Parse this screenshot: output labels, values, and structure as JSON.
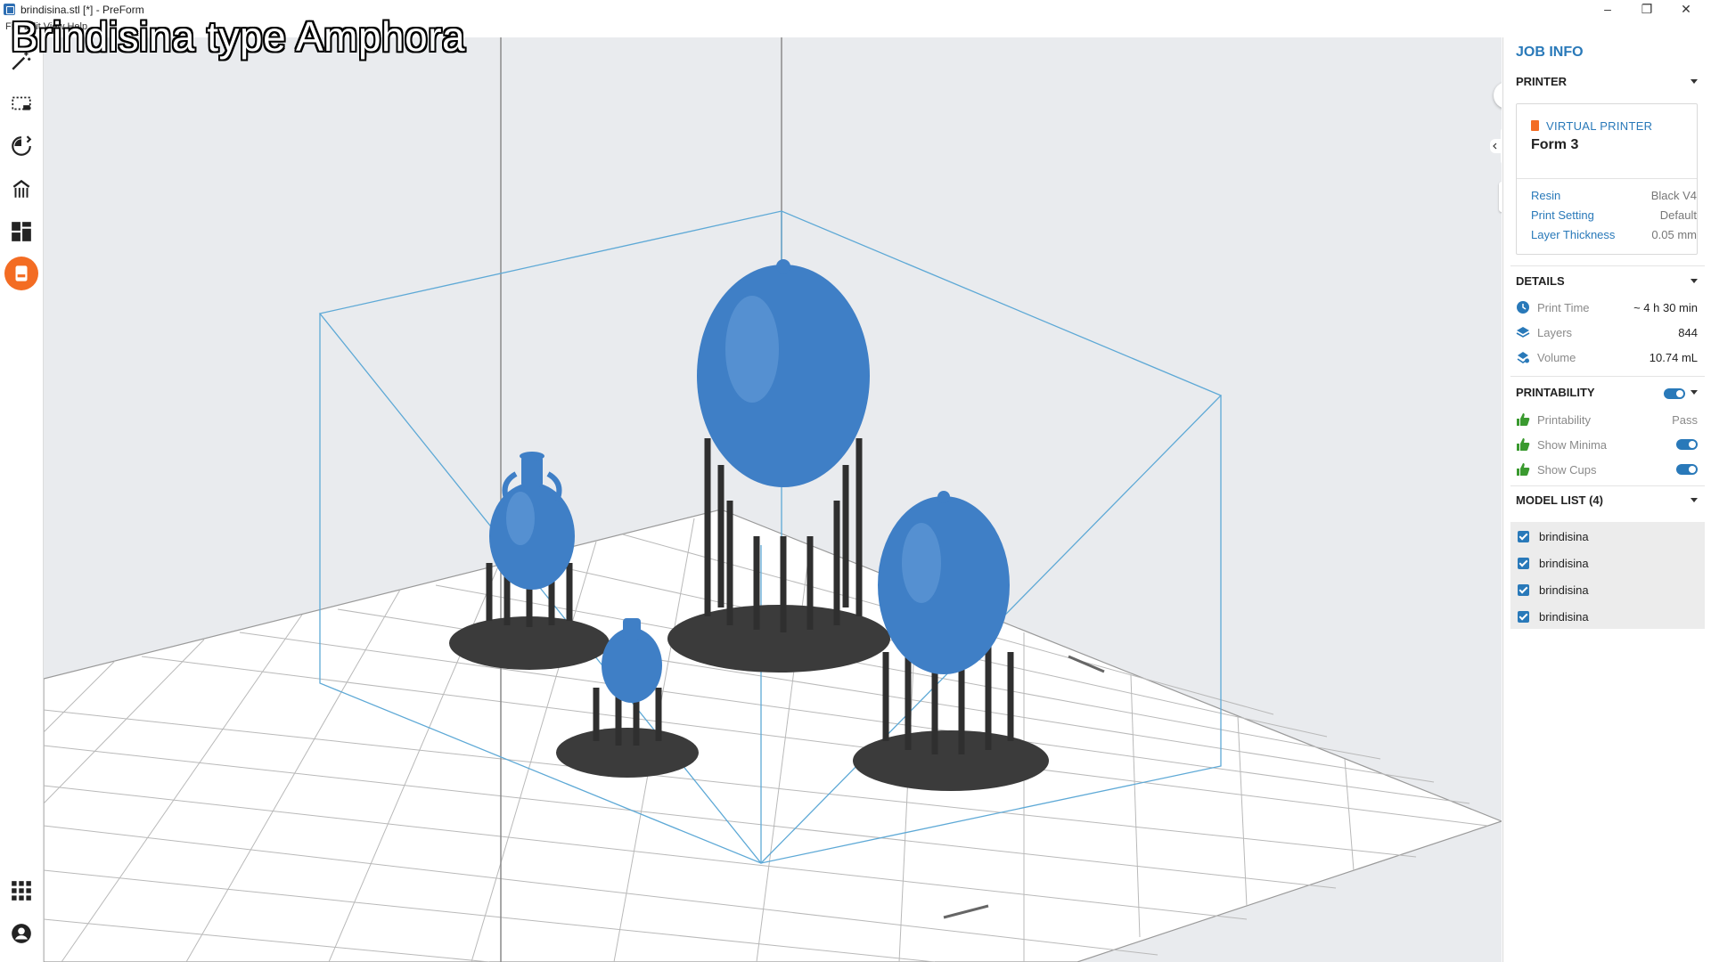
{
  "window": {
    "title": "brindisina.stl [*] - PreForm",
    "menu_ghost": "File  Edit  View  Help",
    "controls": {
      "minimize": "–",
      "maximize": "❐",
      "close": "✕"
    }
  },
  "overlay_caption": "Brindisina type Amphora",
  "toolbar": {
    "tools": [
      "magic-wand",
      "select",
      "orientation",
      "supports",
      "layout",
      "job-info"
    ],
    "bottom": [
      "apps",
      "account"
    ],
    "accent": "#f36c23"
  },
  "viewport": {
    "zoom_in": "+",
    "zoom_out": "−",
    "bg_color": "#e9ebee",
    "model_color": "#3f7fc6",
    "support_color": "#3b3b3b",
    "bbox_color": "#5ea9d6"
  },
  "panel": {
    "title": "JOB INFO",
    "printer": {
      "header": "PRINTER",
      "badge": "VIRTUAL PRINTER",
      "name": "Form 3",
      "rows": [
        {
          "k": "Resin",
          "v": "Black V4"
        },
        {
          "k": "Print Setting",
          "v": "Default"
        },
        {
          "k": "Layer Thickness",
          "v": "0.05 mm"
        }
      ]
    },
    "details": {
      "header": "DETAILS",
      "rows": [
        {
          "icon": "clock-icon",
          "k": "Print Time",
          "v": "~ 4 h 30 min"
        },
        {
          "icon": "layers-icon",
          "k": "Layers",
          "v": "844"
        },
        {
          "icon": "volume-icon",
          "k": "Volume",
          "v": "10.74 mL"
        }
      ]
    },
    "printability": {
      "header": "PRINTABILITY",
      "rows": [
        {
          "k": "Printability",
          "v": "Pass"
        },
        {
          "k": "Show Minima",
          "v": ""
        },
        {
          "k": "Show Cups",
          "v": ""
        }
      ]
    },
    "model_list": {
      "header": "MODEL LIST (4)",
      "items": [
        "brindisina",
        "brindisina",
        "brindisina",
        "brindisina"
      ]
    }
  },
  "accent_color": "#2979b9"
}
